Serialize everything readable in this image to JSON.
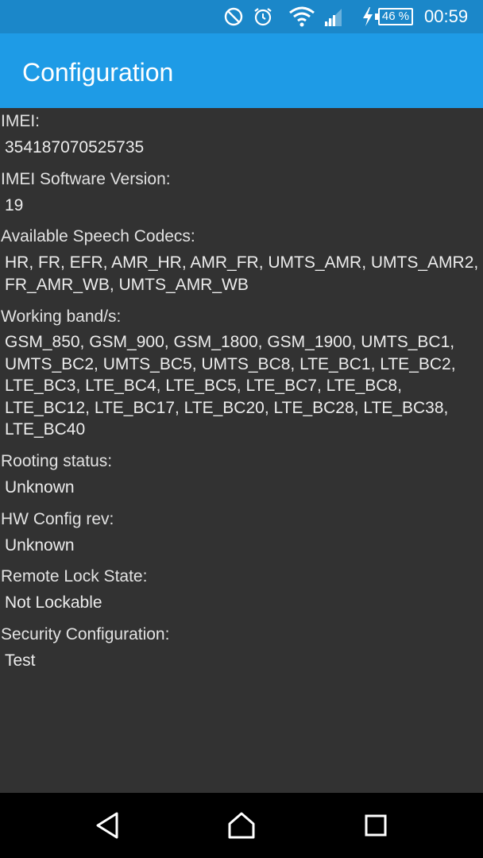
{
  "status_bar": {
    "battery": "46 %",
    "time": "00:59",
    "icons": [
      "do-not-disturb-icon",
      "alarm-icon",
      "wifi-icon",
      "cell-signal-icon",
      "charging-bolt-icon"
    ]
  },
  "app_bar": {
    "title": "Configuration"
  },
  "fields": [
    {
      "label": "IMEI:",
      "value": "354187070525735"
    },
    {
      "label": "IMEI Software Version:",
      "value": "19"
    },
    {
      "label": "Available Speech Codecs:",
      "value": "HR, FR, EFR, AMR_HR, AMR_FR, UMTS_AMR, UMTS_AMR2, FR_AMR_WB, UMTS_AMR_WB"
    },
    {
      "label": "Working band/s:",
      "value": "GSM_850, GSM_900, GSM_1800, GSM_1900, UMTS_BC1, UMTS_BC2, UMTS_BC5, UMTS_BC8, LTE_BC1, LTE_BC2, LTE_BC3, LTE_BC4, LTE_BC5, LTE_BC7, LTE_BC8, LTE_BC12, LTE_BC17, LTE_BC20, LTE_BC28, LTE_BC38, LTE_BC40"
    },
    {
      "label": "Rooting status:",
      "value": "Unknown"
    },
    {
      "label": "HW Config rev:",
      "value": "Unknown"
    },
    {
      "label": "Remote Lock State:",
      "value": "Not Lockable"
    },
    {
      "label": "Security Configuration:",
      "value": "Test"
    }
  ],
  "nav_bar": {
    "icons": [
      "back-icon",
      "home-icon",
      "recents-icon"
    ]
  },
  "colors": {
    "status_bar": "#1b87c9",
    "app_bar": "#1e9be6",
    "background": "#323232",
    "nav_bar": "#000000"
  }
}
